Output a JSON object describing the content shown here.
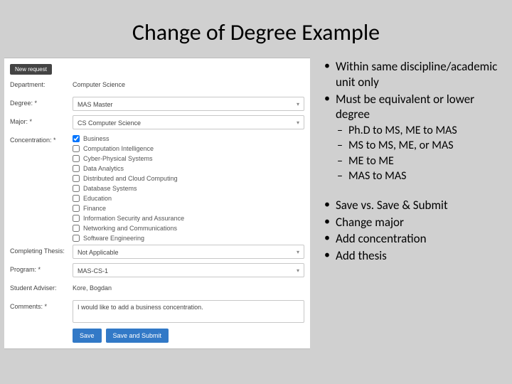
{
  "title": "Change of Degree Example",
  "form": {
    "new_request_btn": "New request",
    "labels": {
      "department": "Department:",
      "degree": "Degree: *",
      "major": "Major: *",
      "concentration": "Concentration: *",
      "completing_thesis": "Completing Thesis:",
      "program": "Program: *",
      "student_adviser": "Student Adviser:",
      "comments": "Comments: *"
    },
    "department_value": "Computer Science",
    "degree_selected": "MAS Master",
    "major_selected": "CS Computer Science",
    "concentrations": [
      {
        "label": "Business",
        "checked": true
      },
      {
        "label": "Computation Intelligence",
        "checked": false
      },
      {
        "label": "Cyber-Physical Systems",
        "checked": false
      },
      {
        "label": "Data Analytics",
        "checked": false
      },
      {
        "label": "Distributed and Cloud Computing",
        "checked": false
      },
      {
        "label": "Database Systems",
        "checked": false
      },
      {
        "label": "Education",
        "checked": false
      },
      {
        "label": "Finance",
        "checked": false
      },
      {
        "label": "Information Security and Assurance",
        "checked": false
      },
      {
        "label": "Networking and Communications",
        "checked": false
      },
      {
        "label": "Software Engineering",
        "checked": false
      }
    ],
    "thesis_selected": "Not Applicable",
    "program_selected": "MAS-CS-1",
    "adviser_value": "Kore, Bogdan",
    "comments_value": "I would like to add a business concentration.",
    "save_btn": "Save",
    "save_submit_btn": "Save and Submit"
  },
  "bullets": {
    "b1": "Within same discipline/academic unit only",
    "b2": "Must be equivalent or lower degree",
    "s1": "Ph.D to MS, ME to MAS",
    "s2": "MS to MS, ME, or MAS",
    "s3": "ME to ME",
    "s4": "MAS to MAS",
    "b3": "Save vs. Save & Submit",
    "b4": "Change major",
    "b5": "Add concentration",
    "b6": "Add thesis"
  }
}
